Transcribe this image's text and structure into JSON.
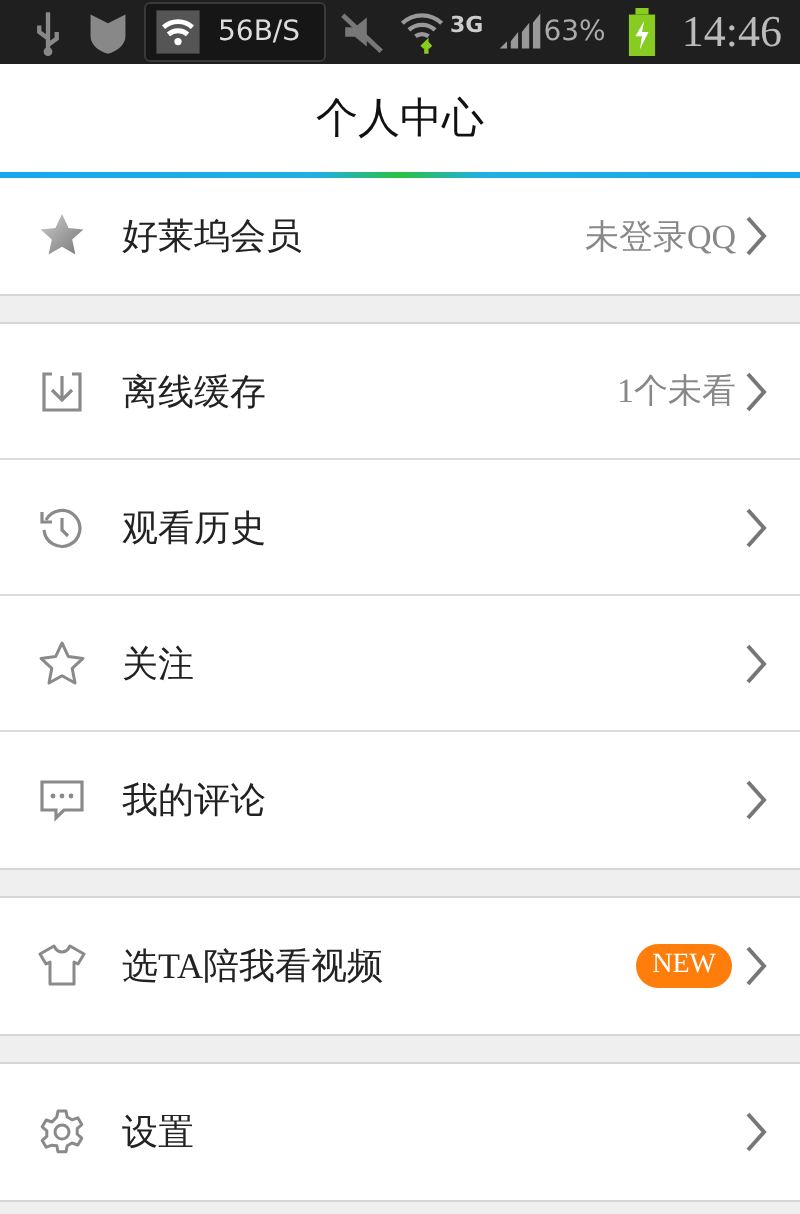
{
  "status_bar": {
    "speed": "56B/S",
    "network": "3G",
    "battery": "63%",
    "time": "14:46"
  },
  "header": {
    "title": "个人中心"
  },
  "sections": [
    {
      "items": [
        {
          "label": "好莱坞会员",
          "value": "未登录QQ"
        }
      ]
    },
    {
      "items": [
        {
          "label": "离线缓存",
          "value": "1个未看"
        },
        {
          "label": "观看历史"
        },
        {
          "label": "关注"
        },
        {
          "label": "我的评论"
        }
      ]
    },
    {
      "items": [
        {
          "label": "选TA陪我看视频",
          "badge": "NEW"
        }
      ]
    },
    {
      "items": [
        {
          "label": "设置"
        }
      ]
    }
  ]
}
